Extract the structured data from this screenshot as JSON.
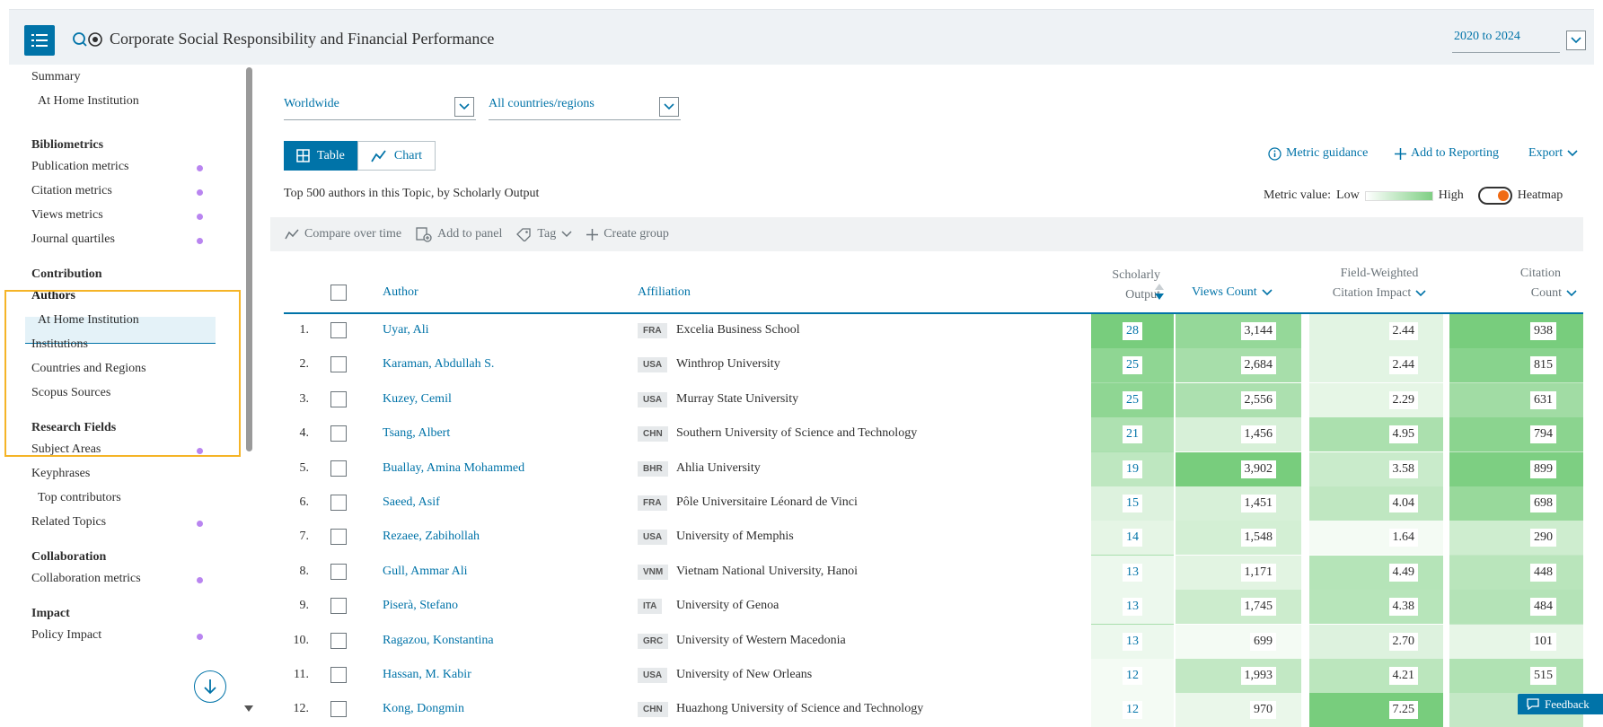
{
  "header": {
    "title": "Corporate Social Responsibility and Financial Performance",
    "year_range": "2020 to 2024"
  },
  "sidebar": {
    "items": [
      {
        "label": "Summary",
        "type": "item"
      },
      {
        "label": "At Home Institution",
        "type": "sub"
      },
      {
        "label": "Bibliometrics",
        "type": "head"
      },
      {
        "label": "Publication metrics",
        "type": "item",
        "dot": true
      },
      {
        "label": "Citation metrics",
        "type": "item",
        "dot": true
      },
      {
        "label": "Views metrics",
        "type": "item",
        "dot": true
      },
      {
        "label": "Journal quartiles",
        "type": "item",
        "dot": true
      },
      {
        "label": "Contribution",
        "type": "head"
      },
      {
        "label": "Authors",
        "type": "active"
      },
      {
        "label": "At Home Institution",
        "type": "sub"
      },
      {
        "label": "Institutions",
        "type": "item"
      },
      {
        "label": "Countries and Regions",
        "type": "item"
      },
      {
        "label": "Scopus Sources",
        "type": "item"
      },
      {
        "label": "Research Fields",
        "type": "head"
      },
      {
        "label": "Subject Areas",
        "type": "item",
        "dot": true
      },
      {
        "label": "Keyphrases",
        "type": "item"
      },
      {
        "label": "Top contributors",
        "type": "sub"
      },
      {
        "label": "Related Topics",
        "type": "item",
        "dot": true
      },
      {
        "label": "Collaboration",
        "type": "head"
      },
      {
        "label": "Collaboration metrics",
        "type": "item",
        "dot": true
      },
      {
        "label": "Impact",
        "type": "head"
      },
      {
        "label": "Policy Impact",
        "type": "item",
        "dot": true
      }
    ]
  },
  "filters": {
    "region": "Worldwide",
    "country": "All countries/regions"
  },
  "view_toggle": {
    "table": "Table",
    "chart": "Chart",
    "selected": "table"
  },
  "actions": {
    "metric_guidance": "Metric guidance",
    "add_to_reporting": "Add to Reporting",
    "export": "Export"
  },
  "caption": "Top 500 authors in this Topic, by Scholarly Output",
  "legend": {
    "label": "Metric value:",
    "low": "Low",
    "high": "High",
    "heatmap": "Heatmap",
    "heatmap_on": true
  },
  "toolbar": {
    "compare": "Compare over time",
    "add_panel": "Add to panel",
    "tag": "Tag",
    "create_group": "Create group"
  },
  "table": {
    "columns": {
      "author": "Author",
      "affiliation": "Affiliation",
      "so_1": "Scholarly",
      "so_2": "Output",
      "views": "Views Count",
      "fwci_1": "Field-Weighted",
      "fwci_2": "Citation Impact",
      "cit_1": "Citation",
      "cit_2": "Count"
    },
    "rows": [
      {
        "n": "1.",
        "author": "Uyar, Ali",
        "cc": "FRA",
        "inst": "Excelia Business School",
        "so": "28",
        "views": "3,144",
        "fwci": "2.44",
        "cit": "938"
      },
      {
        "n": "2.",
        "author": "Karaman, Abdullah S.",
        "cc": "USA",
        "inst": "Winthrop University",
        "so": "25",
        "views": "2,684",
        "fwci": "2.44",
        "cit": "815"
      },
      {
        "n": "3.",
        "author": "Kuzey, Cemil",
        "cc": "USA",
        "inst": "Murray State University",
        "so": "25",
        "views": "2,556",
        "fwci": "2.29",
        "cit": "631"
      },
      {
        "n": "4.",
        "author": "Tsang, Albert",
        "cc": "CHN",
        "inst": "Southern University of Science and Technology",
        "so": "21",
        "views": "1,456",
        "fwci": "4.95",
        "cit": "794"
      },
      {
        "n": "5.",
        "author": "Buallay, Amina Mohammed",
        "cc": "BHR",
        "inst": "Ahlia University",
        "so": "19",
        "views": "3,902",
        "fwci": "3.58",
        "cit": "899"
      },
      {
        "n": "6.",
        "author": "Saeed, Asif",
        "cc": "FRA",
        "inst": "Pôle Universitaire Léonard de Vinci",
        "so": "15",
        "views": "1,451",
        "fwci": "4.04",
        "cit": "698"
      },
      {
        "n": "7.",
        "author": "Rezaee, Zabihollah",
        "cc": "USA",
        "inst": "University of Memphis",
        "so": "14",
        "views": "1,548",
        "fwci": "1.64",
        "cit": "290"
      },
      {
        "n": "8.",
        "author": "Gull, Ammar Ali",
        "cc": "VNM",
        "inst": "Vietnam National University, Hanoi",
        "so": "13",
        "views": "1,171",
        "fwci": "4.49",
        "cit": "448"
      },
      {
        "n": "9.",
        "author": "Piserà, Stefano",
        "cc": "ITA",
        "inst": "University of Genoa",
        "so": "13",
        "views": "1,745",
        "fwci": "4.38",
        "cit": "484"
      },
      {
        "n": "10.",
        "author": "Ragazou, Konstantina",
        "cc": "GRC",
        "inst": "University of Western Macedonia",
        "so": "13",
        "views": "699",
        "fwci": "2.70",
        "cit": "101"
      },
      {
        "n": "11.",
        "author": "Hassan, M. Kabir",
        "cc": "USA",
        "inst": "University of New Orleans",
        "so": "12",
        "views": "1,993",
        "fwci": "4.21",
        "cit": "515"
      },
      {
        "n": "12.",
        "author": "Kong, Dongmin",
        "cc": "CHN",
        "inst": "Huazhong University of Science and Technology",
        "so": "12",
        "views": "970",
        "fwci": "7.25",
        "cit": ""
      }
    ]
  },
  "feedback": "Feedback",
  "colors": {
    "accent": "#0073a8",
    "heat_high": "#7fcf84",
    "highlight": "#f5b427",
    "dot": "#b985f0"
  }
}
